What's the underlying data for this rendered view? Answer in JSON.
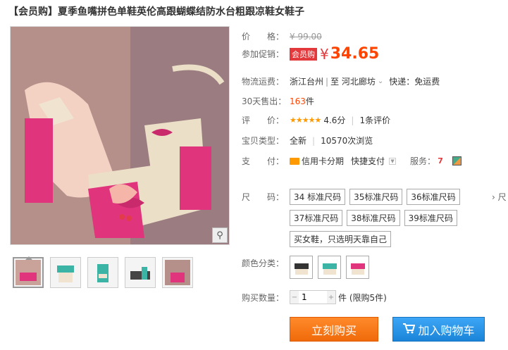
{
  "title": "【会员购】夏季鱼嘴拼色单鞋英伦高跟蝴蝶结防水台粗跟凉鞋女鞋子",
  "price": {
    "label": "价　　格：",
    "original": "¥ 99.00"
  },
  "promo": {
    "label": "参加促销：",
    "badge": "会员购",
    "yen": "¥",
    "value": "34.65"
  },
  "shipping": {
    "label": "物流运费：",
    "from": "浙江台州",
    "to": "至  河北廊坊",
    "chevron": "⌄",
    "method": "快递：免运费"
  },
  "sales": {
    "label": "30天售出：",
    "count": "163",
    "unit": "件"
  },
  "rating": {
    "label": "评　　价：",
    "stars": "★★★★★",
    "score": "4.6分",
    "reviews": "1条评价"
  },
  "type": {
    "label": "宝贝类型：",
    "condition": "全新",
    "views": "10570次浏览"
  },
  "payment": {
    "label": "支　　付：",
    "method": "信用卡分期",
    "quick": "快捷支付",
    "service_label": "服务："
  },
  "size": {
    "label": "尺　　码：",
    "options": [
      "34 标准尺码",
      "35标准尺码",
      "36标准尺码",
      "37标准尺码",
      "38标准尺码",
      "39标准尺码",
      "买女鞋，只选明天靠自己"
    ],
    "overflow": "›  尺"
  },
  "color": {
    "label": "颜色分类："
  },
  "quantity": {
    "label": "购买数量：",
    "value": "1",
    "unit": "件 (限购5件)"
  },
  "buttons": {
    "buy": "立刻购买",
    "cart": "加入购物车"
  },
  "colors_hex": {
    "accent": "#ff4400",
    "buy_bg": "#f57a1c",
    "cart_bg": "#2a94e8",
    "badge_bg": "#e4393c"
  },
  "icons": {
    "zoom": "magnifier-icon",
    "cart": "cart-icon",
    "credit": "credit-card-icon"
  }
}
